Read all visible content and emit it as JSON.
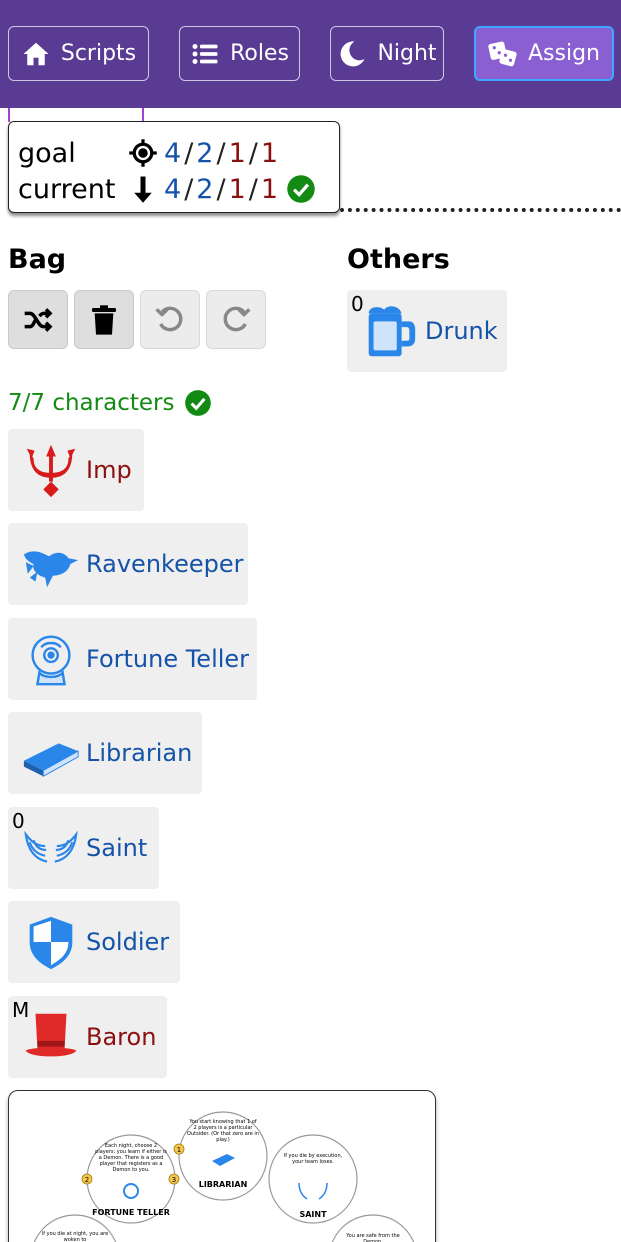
{
  "nav": {
    "scripts": "Scripts",
    "roles": "Roles",
    "night": "Night",
    "assign": "Assign"
  },
  "counts": {
    "goal_label": "goal",
    "current_label": "current",
    "goal": [
      "4",
      "2",
      "1",
      "1"
    ],
    "current": [
      "4",
      "2",
      "1",
      "1"
    ],
    "separator": "/"
  },
  "bag": {
    "title": "Bag",
    "status": "7/7 characters",
    "characters": [
      {
        "name": "Imp",
        "team": "evil",
        "icon": "trident-icon",
        "badge": ""
      },
      {
        "name": "Ravenkeeper",
        "team": "town",
        "icon": "raven-icon",
        "badge": ""
      },
      {
        "name": "Fortune Teller",
        "team": "town",
        "icon": "crystal-ball-icon",
        "badge": ""
      },
      {
        "name": "Librarian",
        "team": "town",
        "icon": "book-icon",
        "badge": ""
      },
      {
        "name": "Saint",
        "team": "town",
        "icon": "wings-icon",
        "badge": "0"
      },
      {
        "name": "Soldier",
        "team": "town",
        "icon": "shield-icon",
        "badge": ""
      },
      {
        "name": "Baron",
        "team": "evil",
        "icon": "top-hat-icon",
        "badge": "M"
      }
    ]
  },
  "others": {
    "title": "Others",
    "characters": [
      {
        "name": "Drunk",
        "team": "town",
        "icon": "beer-mug-icon",
        "badge": "0"
      }
    ]
  },
  "sheet": {
    "librarian_text": "You start knowing that 1 of 2 players is a particular Outsider. (Or that zero are in play.)",
    "librarian_name": "LIBRARIAN",
    "fortune_text": "Each night, choose 2 players: you learn if either is a Demon. There is a good player that registers as a Demon to you.",
    "fortune_name": "FORTUNE TELLER",
    "saint_text": "If you die by execution, your team loses.",
    "saint_name": "SAINT",
    "left_text": "If you die at night, you are woken to",
    "right_text": "You are safe from the Demon.",
    "markers": [
      "1",
      "2",
      "3"
    ]
  },
  "colors": {
    "nav_bg": "#5a3b93",
    "nav_active": "#8a5fd1",
    "townsfolk": "#1553a8",
    "evil": "#8c1010",
    "ok": "#138a13"
  }
}
